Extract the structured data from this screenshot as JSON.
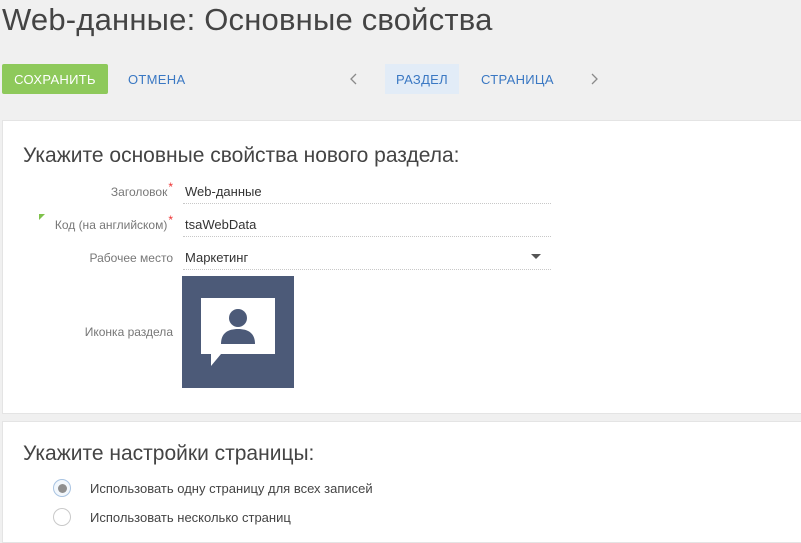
{
  "header": {
    "title": "Web-данные: Основные свойства"
  },
  "toolbar": {
    "save_label": "СОХРАНИТЬ",
    "cancel_label": "ОТМЕНА",
    "prev_icon": "chevron-left-icon",
    "next_icon": "chevron-right-icon",
    "tabs": [
      {
        "label": "РАЗДЕЛ",
        "active": true
      },
      {
        "label": "СТРАНИЦА",
        "active": false
      }
    ]
  },
  "section_props": {
    "heading": "Укажите основные свойства нового раздела:",
    "fields": {
      "title": {
        "label": "Заголовок",
        "value": "Web-данные",
        "required": true
      },
      "code": {
        "label": "Код (на английском)",
        "value": "tsaWebData",
        "required": true
      },
      "workplace": {
        "label": "Рабочее место",
        "value": "Маркетинг"
      },
      "icon": {
        "label": "Иконка раздела",
        "icon_name": "contact-person-icon"
      }
    },
    "required_mark": "*"
  },
  "page_settings": {
    "heading": "Укажите настройки страницы:",
    "options": [
      {
        "label": "Использовать одну страницу для всех записей",
        "checked": true
      },
      {
        "label": "Использовать несколько страниц",
        "checked": false
      }
    ]
  },
  "colors": {
    "save_button": "#8ec95b",
    "link": "#3a78c3",
    "active_tab_bg": "#e2ecf7",
    "icon_bg": "#4c5a78",
    "required": "#ee3333"
  }
}
